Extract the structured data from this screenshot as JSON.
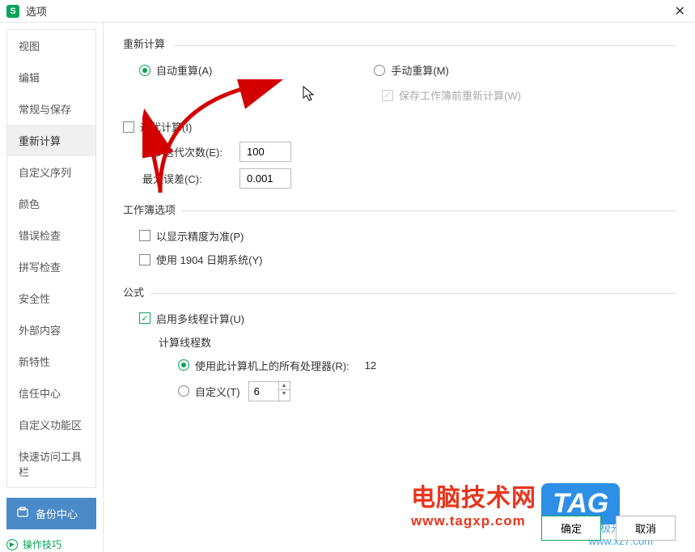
{
  "titlebar": {
    "app_letter": "S",
    "title": "选项"
  },
  "sidebar": {
    "items": [
      "视图",
      "编辑",
      "常规与保存",
      "重新计算",
      "自定义序列",
      "颜色",
      "错误检查",
      "拼写检查",
      "安全性",
      "外部内容",
      "新特性",
      "信任中心",
      "自定义功能区",
      "快速访问工具栏"
    ],
    "active_index": 3,
    "backup": "备份中心",
    "tips": "操作技巧"
  },
  "recalc": {
    "legend": "重新计算",
    "auto": "自动重算(A)",
    "manual": "手动重算(M)",
    "save_before": "保存工作簿前重新计算(W)"
  },
  "iter": {
    "checkbox": "迭代计算(I)",
    "max_iter_label": "最多迭代次数(E):",
    "max_iter_value": "100",
    "max_diff_label": "最大误差(C):",
    "max_diff_value": "0.001"
  },
  "workbook": {
    "legend": "工作簿选项",
    "precision": "以显示精度为准(P)",
    "date1904": "使用 1904 日期系统(Y)"
  },
  "formula": {
    "legend": "公式",
    "multithread": "启用多线程计算(U)",
    "threads_title": "计算线程数",
    "use_all": "使用此计算机上的所有处理器(R):",
    "processor_count": "12",
    "custom_label": "自定义(T)",
    "custom_value": "6"
  },
  "footer": {
    "ok": "确定",
    "cancel": "取消"
  },
  "watermark": {
    "site1": "极光下载站",
    "site1_url": "www.xz7.com",
    "site2": "电脑技术网",
    "site2_url": "www.tagxp.com",
    "tag": "TAG"
  }
}
